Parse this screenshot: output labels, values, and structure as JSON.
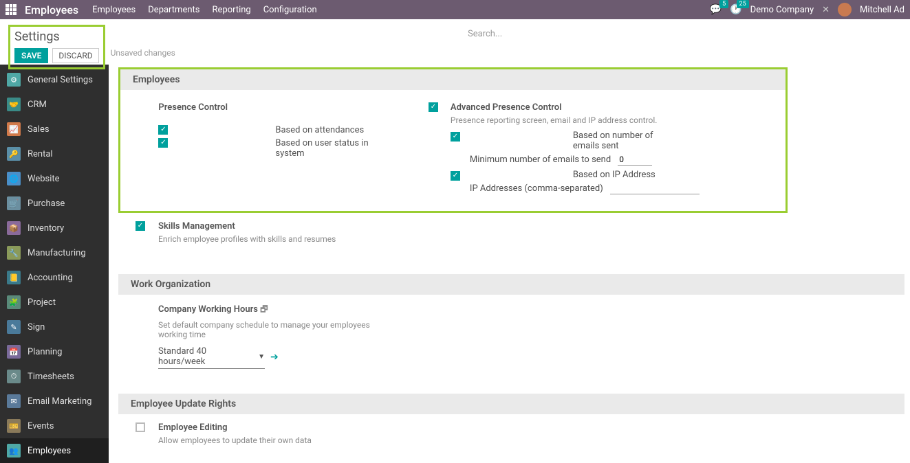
{
  "navbar": {
    "app_title": "Employees",
    "links": [
      "Employees",
      "Departments",
      "Reporting",
      "Configuration"
    ],
    "msg_badge": "5",
    "clock_badge": "25",
    "company": "Demo Company",
    "user": "Mitchell Ad"
  },
  "subheader": {
    "title": "Settings",
    "save": "SAVE",
    "discard": "DISCARD",
    "unsaved": "Unsaved changes",
    "search_placeholder": "Search..."
  },
  "sidebar": {
    "items": [
      "General Settings",
      "CRM",
      "Sales",
      "Rental",
      "Website",
      "Purchase",
      "Inventory",
      "Manufacturing",
      "Accounting",
      "Project",
      "Sign",
      "Planning",
      "Timesheets",
      "Email Marketing",
      "Events",
      "Employees"
    ]
  },
  "sections": {
    "employees": {
      "title": "Employees",
      "presence": {
        "title": "Presence Control",
        "opt1": "Based on attendances",
        "opt2": "Based on user status in system"
      },
      "advanced": {
        "title": "Advanced Presence Control",
        "desc": "Presence reporting screen, email and IP address control.",
        "emails_label": "Based on number of emails sent",
        "min_emails_label": "Minimum number of emails to send",
        "min_emails_value": "0",
        "ip_label": "Based on IP Address",
        "ip_input_label": "IP Addresses (comma-separated)"
      },
      "skills": {
        "title": "Skills Management",
        "desc": "Enrich employee profiles with skills and resumes"
      }
    },
    "work_org": {
      "title": "Work Organization",
      "hours": {
        "title": "Company Working Hours",
        "desc": "Set default company schedule to manage your employees working time",
        "value": "Standard 40 hours/week"
      }
    },
    "update_rights": {
      "title": "Employee Update Rights",
      "editing": {
        "title": "Employee Editing",
        "desc": "Allow employees to update their own data"
      }
    }
  }
}
